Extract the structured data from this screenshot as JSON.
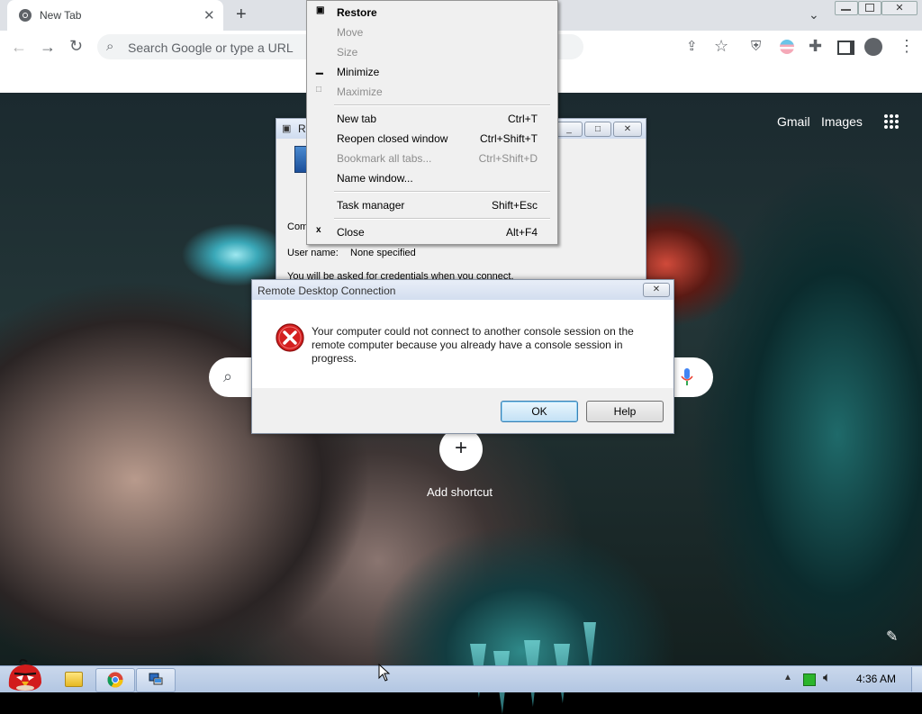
{
  "browser": {
    "tab_title": "New Tab",
    "omnibox_placeholder": "Search Google or type a URL",
    "ntp": {
      "links": [
        "Gmail",
        "Images"
      ],
      "add_shortcut_label": "Add shortcut"
    }
  },
  "context_menu": {
    "items": [
      {
        "label": "Restore",
        "shortcut": "",
        "disabled": false,
        "bold": true
      },
      {
        "label": "Move",
        "shortcut": "",
        "disabled": true
      },
      {
        "label": "Size",
        "shortcut": "",
        "disabled": true
      },
      {
        "label": "Minimize",
        "shortcut": "",
        "disabled": false
      },
      {
        "label": "Maximize",
        "shortcut": "",
        "disabled": true
      },
      {
        "label": "New tab",
        "shortcut": "Ctrl+T",
        "disabled": false
      },
      {
        "label": "Reopen closed window",
        "shortcut": "Ctrl+Shift+T",
        "disabled": false
      },
      {
        "label": "Bookmark all tabs...",
        "shortcut": "Ctrl+Shift+D",
        "disabled": true
      },
      {
        "label": "Name window...",
        "shortcut": "",
        "disabled": false
      },
      {
        "label": "Task manager",
        "shortcut": "Shift+Esc",
        "disabled": false
      },
      {
        "label": "Close",
        "shortcut": "Alt+F4",
        "disabled": false
      }
    ]
  },
  "rdc_window": {
    "title_partial": "R",
    "computer_label_partial": "Com",
    "user_name_label": "User name:",
    "user_name_value": "None specified",
    "credentials_note": "You will be asked for credentials when you connect."
  },
  "error_dialog": {
    "title": "Remote Desktop Connection",
    "message": "Your computer could not connect to another console session on the remote computer because you already have a console session in progress.",
    "ok_label": "OK",
    "help_label": "Help"
  },
  "taskbar": {
    "time": "4:36 AM"
  },
  "colors": {
    "error_red": "#d42020",
    "taskbar": "#c4d4eb",
    "context_menu_bg": "#f0f0f0"
  }
}
